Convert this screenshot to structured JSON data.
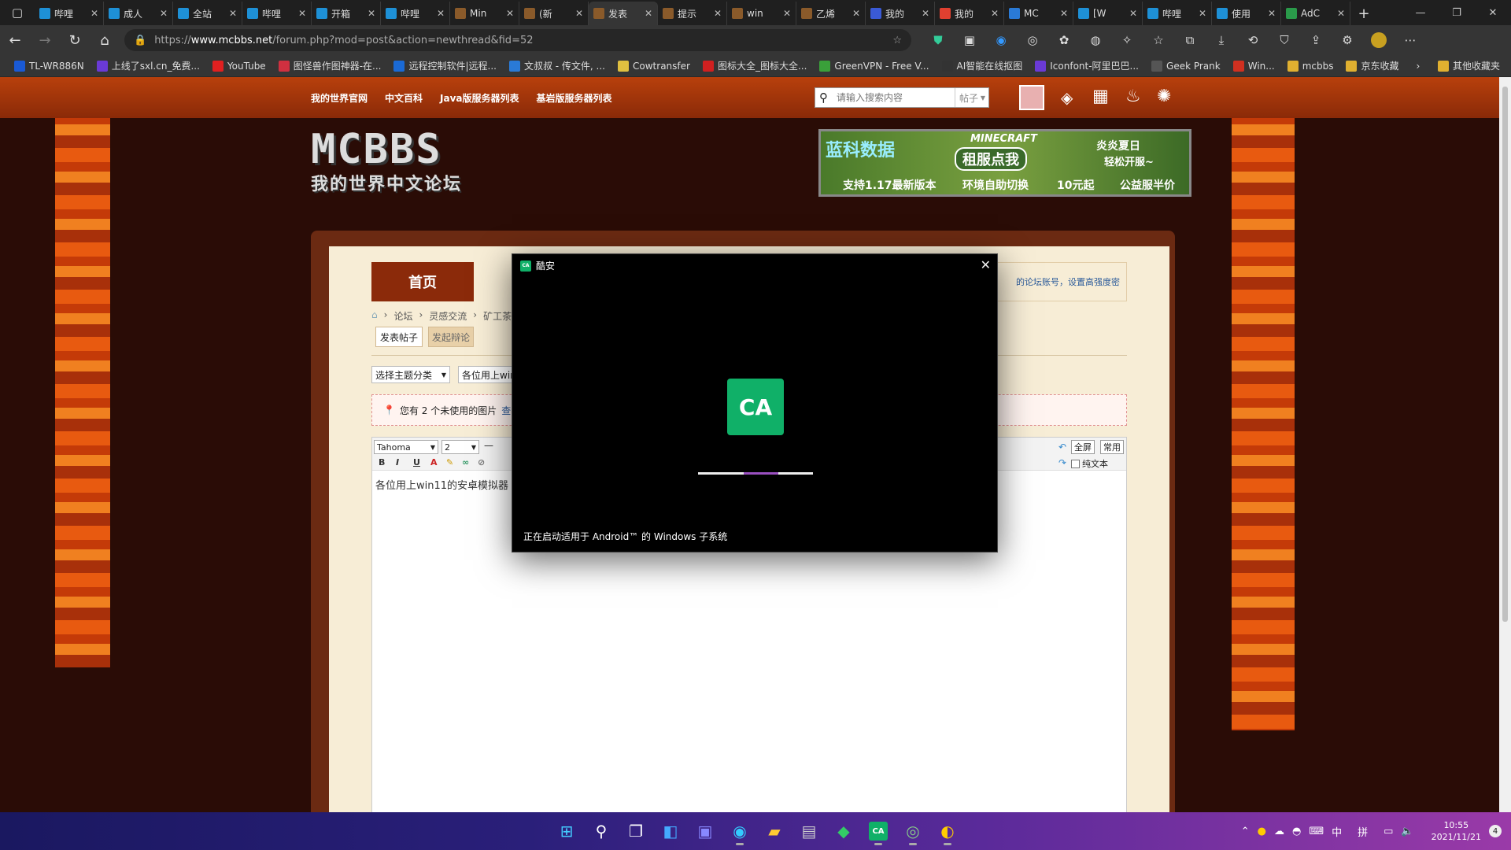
{
  "browser": {
    "tabs": [
      {
        "title": "哔哩",
        "color": "#1e90d6",
        "icon": "bilibili-icon"
      },
      {
        "title": "成人",
        "color": "#1e90d6",
        "icon": "bilibili-icon"
      },
      {
        "title": "全站",
        "color": "#1e90d6",
        "icon": "bilibili-icon"
      },
      {
        "title": "哔哩",
        "color": "#1e90d6",
        "icon": "bilibili-icon"
      },
      {
        "title": "开箱",
        "color": "#1e90d6",
        "icon": "bilibili-icon"
      },
      {
        "title": "哔哩",
        "color": "#1e90d6",
        "icon": "bilibili-icon"
      },
      {
        "title": "Min",
        "color": "#8a5a2a",
        "icon": "minecraft-icon"
      },
      {
        "title": "(新",
        "color": "#8a5a2a",
        "icon": "minecraft-icon"
      },
      {
        "title": "发表",
        "color": "#8a5a2a",
        "icon": "minecraft-icon",
        "active": true
      },
      {
        "title": "提示",
        "color": "#8a5a2a",
        "icon": "minecraft-icon"
      },
      {
        "title": "win",
        "color": "#8a5a2a",
        "icon": "minecraft-icon"
      },
      {
        "title": "乙烯",
        "color": "#8a5a2a",
        "icon": "minecraft-icon"
      },
      {
        "title": "我的",
        "color": "#3a5ad6",
        "icon": "baidu-icon"
      },
      {
        "title": "我的",
        "color": "#e04030",
        "icon": "google-icon"
      },
      {
        "title": "MC",
        "color": "#2a7ad6",
        "icon": "check-icon"
      },
      {
        "title": "[W",
        "color": "#1e90d6",
        "icon": "bilibili-icon"
      },
      {
        "title": "哔哩",
        "color": "#1e90d6",
        "icon": "bilibili-icon"
      },
      {
        "title": "使用",
        "color": "#1e90d6",
        "icon": "bilibili-icon"
      },
      {
        "title": "AdC",
        "color": "#2a9a4a",
        "icon": "shield-icon"
      }
    ],
    "url_prefix": "https://",
    "url_domain": "www.mcbbs.net",
    "url_path": "/forum.php?mod=post&action=newthread&fid=52",
    "bookmarks": [
      {
        "label": "TL-WR886N",
        "color": "#1a5ad6",
        "icon": "router-icon"
      },
      {
        "label": "上线了sxl.cn_免费...",
        "color": "#6a3ad6",
        "icon": "s-icon"
      },
      {
        "label": "YouTube",
        "color": "#e02020",
        "icon": "youtube-icon"
      },
      {
        "label": "图怪兽作图神器-在...",
        "color": "#d03040",
        "icon": "tuguaishou-icon"
      },
      {
        "label": "远程控制软件|远程...",
        "color": "#1a6ad6",
        "icon": "remote-icon"
      },
      {
        "label": "文叔叔 - 传文件, ...",
        "color": "#2a7ad6",
        "icon": "wenshushu-icon"
      },
      {
        "label": "Cowtransfer",
        "color": "#e0c040",
        "icon": "cow-icon"
      },
      {
        "label": "图标大全_图标大全...",
        "color": "#d02020",
        "icon": "a-icon"
      },
      {
        "label": "GreenVPN - Free V...",
        "color": "#3aa03a",
        "icon": "vpn-icon"
      },
      {
        "label": "AI智能在线抠图",
        "color": "#333333",
        "icon": "ai-icon"
      },
      {
        "label": "Iconfont-阿里巴巴...",
        "color": "#6a3ad6",
        "icon": "iconfont-icon"
      },
      {
        "label": "Geek Prank",
        "color": "#555555",
        "icon": "geek-icon"
      },
      {
        "label": "Win...",
        "color": "#d03020",
        "icon": "win-icon"
      },
      {
        "label": "mcbbs",
        "color": "#e0b030",
        "icon": "folder-icon"
      },
      {
        "label": "京东收藏",
        "color": "#e0b030",
        "icon": "folder-icon"
      }
    ],
    "other_bookmarks": "其他收藏夹"
  },
  "site": {
    "nav": [
      "我的世界官网",
      "中文百科",
      "Java版服务器列表",
      "基岩版服务器列表"
    ],
    "search_placeholder": "请输入搜索内容",
    "search_scope": "帖子",
    "logo_big": "MCBBS",
    "logo_sub": "我的世界中文论坛",
    "ad": {
      "brand": "蓝科数据",
      "line1": "MINECRAFT",
      "cta": "租服点我",
      "right1": "炎炎夏日",
      "right2": "轻松开服~",
      "b1": "支持1.17最新版本",
      "b2": "环境自助切换",
      "b3": "10元起",
      "b4": "公益服半价"
    }
  },
  "forum": {
    "home_tab": "首页",
    "right_notice": "的论坛账号，设置高强度密",
    "breadcrumb": [
      "论坛",
      "灵感交流",
      "矿工茶"
    ],
    "post_tabs": [
      "发表帖子",
      "发起辩论"
    ],
    "type_select": "选择主题分类",
    "title_value": "各位用上win",
    "image_note": "您有 2 个未使用的图片",
    "image_note_link": "查看",
    "editor": {
      "font": "Tahoma",
      "size": "2",
      "fullscreen": "全屏",
      "common": "常用",
      "plain_text": "纯文本",
      "buttons": [
        "B",
        "I",
        "U",
        "A"
      ],
      "content": "各位用上win11的安卓模拟器"
    }
  },
  "dialog": {
    "app_name": "酷安",
    "logo_glyph": "CA",
    "status": "正在启动适用于 Android™ 的 Windows 子系统",
    "progress": 0.3
  },
  "taskbar": {
    "clock_time": "10:55",
    "clock_date": "2021/11/21",
    "ime_lang": "中",
    "ime_mode": "拼",
    "notifications": "4"
  }
}
